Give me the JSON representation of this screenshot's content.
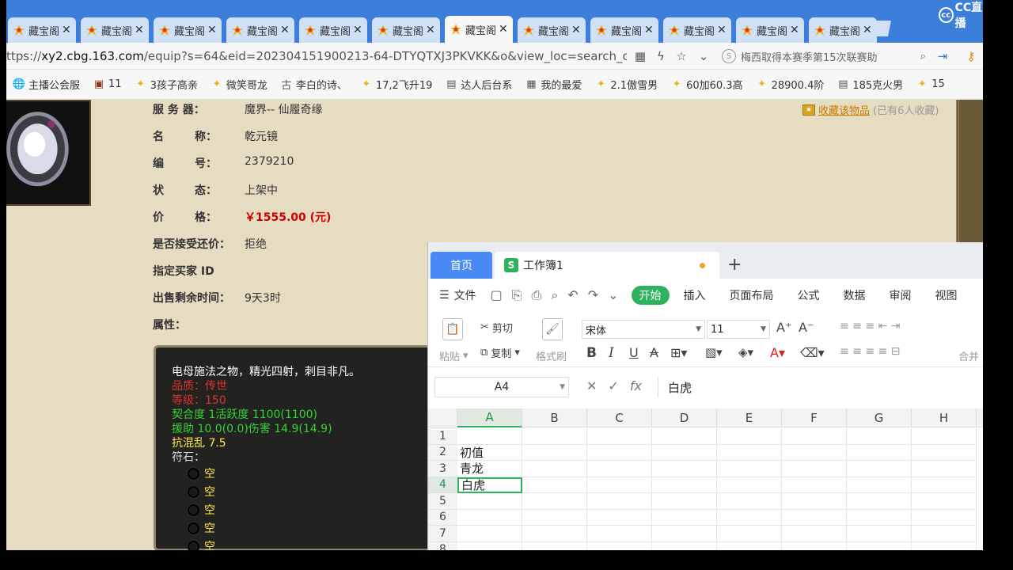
{
  "browser": {
    "tabs": [
      {
        "title": "藏宝阁",
        "active": false
      },
      {
        "title": "藏宝阁",
        "active": false
      },
      {
        "title": "藏宝阁",
        "active": false
      },
      {
        "title": "藏宝阁",
        "active": false
      },
      {
        "title": "藏宝阁",
        "active": false
      },
      {
        "title": "藏宝阁",
        "active": false
      },
      {
        "title": "藏宝阁",
        "active": true
      },
      {
        "title": "藏宝阁",
        "active": false
      },
      {
        "title": "藏宝阁",
        "active": false
      },
      {
        "title": "藏宝阁",
        "active": false
      },
      {
        "title": "藏宝阁",
        "active": false
      },
      {
        "title": "藏宝阁",
        "active": false
      }
    ],
    "stream_logo": "CC直播",
    "url_prefix": "ttps://",
    "url_host": "xy2.cbg.163.com",
    "url_path": "/equip?s=64&eid=202304151900213-64-DTYQTXJ3PKVKK&o&view_loc=search_c",
    "search_text": "梅西取得本赛季第15次联赛助",
    "bookmarks": [
      {
        "label": "主播公会服",
        "icon": "globe-icon"
      },
      {
        "label": "11",
        "icon": "game-icon"
      },
      {
        "label": "3孩子高亲",
        "icon": "cbg-icon"
      },
      {
        "label": "微笑哥龙",
        "icon": "cbg-icon"
      },
      {
        "label": "李白的诗、",
        "icon": "poem-icon"
      },
      {
        "label": "17,2飞升19",
        "icon": "cbg-icon"
      },
      {
        "label": "达人后台系",
        "icon": "doc-icon"
      },
      {
        "label": "我的最爱",
        "icon": "grid-icon"
      },
      {
        "label": "2.1傲雪男",
        "icon": "cbg-icon"
      },
      {
        "label": "60加60.3高",
        "icon": "cbg-icon"
      },
      {
        "label": "28900.4阶",
        "icon": "cbg-icon"
      },
      {
        "label": "185克火男",
        "icon": "doc-icon"
      },
      {
        "label": "15",
        "icon": "cbg-icon"
      }
    ]
  },
  "item": {
    "collect_link": "收藏该物品",
    "collect_count": "(已有6人收藏)",
    "rows": [
      {
        "label": "服 务 器：",
        "value": "魔界-- 仙履奇缘"
      },
      {
        "label": "名        称：",
        "value": "乾元镜"
      },
      {
        "label": "编        号：",
        "value": "2379210"
      },
      {
        "label": "状        态：",
        "value": "上架中"
      },
      {
        "label": "价        格：",
        "value": "￥1555.00 (元)"
      },
      {
        "label": "是否接受还价：",
        "value": "拒绝"
      },
      {
        "label": "指定买家 ID",
        "value": ""
      },
      {
        "label": "出售剩余时间：",
        "value": "9天3时"
      },
      {
        "label": "属性：",
        "value": ""
      }
    ],
    "tooltip": {
      "description": "电母施法之物，精光四射，刺目非凡。",
      "quality": "品质：传世",
      "level": "等级：150",
      "stat1": "契合度     1活跃度  1100(1100)",
      "stat2": "援助     10.0(0.0)伤害     14.9(14.9)",
      "stat3": "抗混乱 7.5",
      "runes_label": "符石：",
      "runes": [
        "空",
        "空",
        "空",
        "空",
        "空"
      ]
    }
  },
  "wps": {
    "home_tab": "首页",
    "doc_tab": "工作簿1",
    "doc_icon": "S",
    "menu": {
      "file": "文件",
      "start": "开始",
      "items": [
        "插入",
        "页面布局",
        "公式",
        "数据",
        "审阅",
        "视图"
      ]
    },
    "ribbon": {
      "paste": "粘贴",
      "cut": "剪切",
      "copy": "复制",
      "format_painter": "格式刷",
      "font": "宋体",
      "size": "11",
      "merge": "合并"
    },
    "name_box": "A4",
    "formula_value": "白虎",
    "columns": [
      "A",
      "B",
      "C",
      "D",
      "E",
      "F",
      "G",
      "H"
    ],
    "rows": [
      "1",
      "2",
      "3",
      "4",
      "5",
      "6",
      "7",
      "8"
    ],
    "cells": {
      "A2": "初值",
      "A3": "青龙",
      "A4": "白虎"
    }
  }
}
